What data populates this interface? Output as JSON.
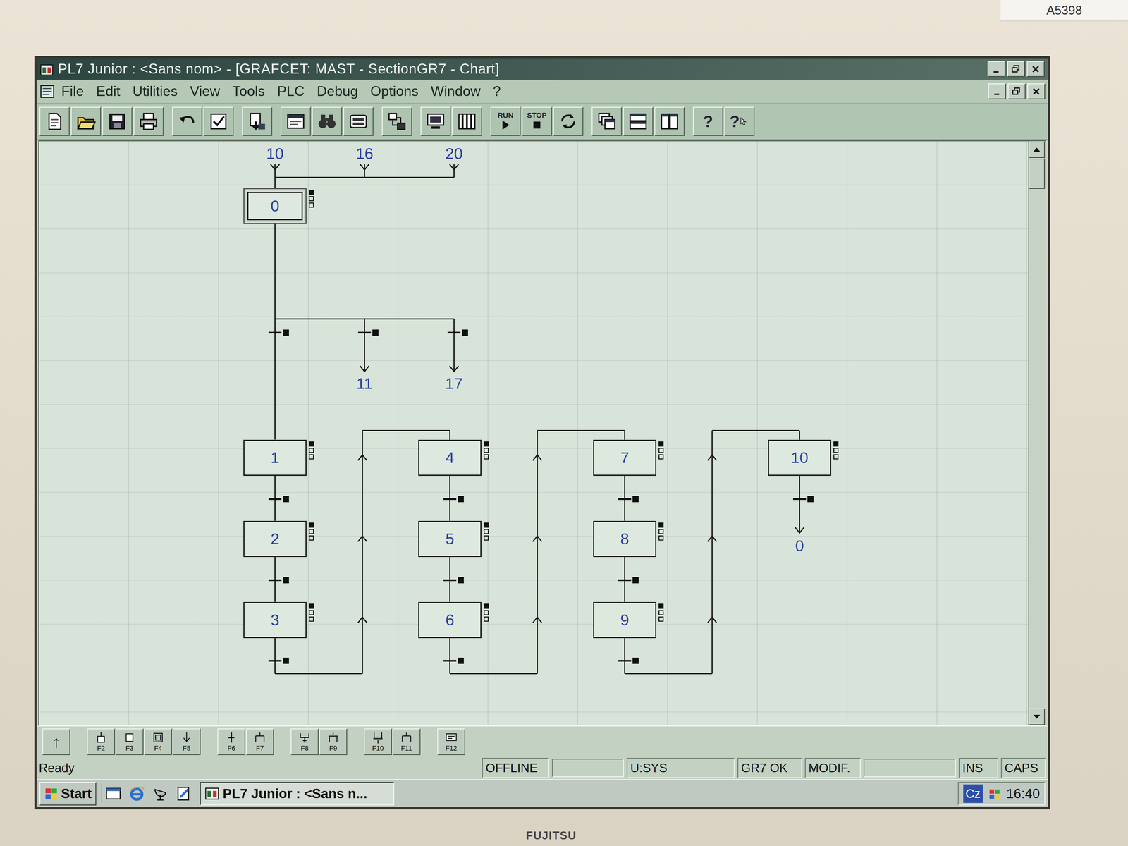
{
  "sticker": "A5398",
  "brand": "FUJITSU",
  "window": {
    "title": "PL7 Junior : <Sans nom> - [GRAFCET: MAST - SectionGR7 - Chart]"
  },
  "menu": [
    "File",
    "Edit",
    "Utilities",
    "View",
    "Tools",
    "PLC",
    "Debug",
    "Options",
    "Window",
    "?"
  ],
  "toolbar": [
    {
      "label": "RUN"
    },
    {
      "label": "STOP"
    },
    {
      "label": "?"
    },
    {
      "label": "?"
    }
  ],
  "chart": {
    "inputs": [
      "10",
      "16",
      "20"
    ],
    "initial_step": {
      "label": "0",
      "initial": true
    },
    "branches": [
      "11",
      "17"
    ],
    "sequences": [
      {
        "steps": [
          "1",
          "2",
          "3"
        ],
        "to_next": true
      },
      {
        "steps": [
          "4",
          "5",
          "6"
        ],
        "to_next": true
      },
      {
        "steps": [
          "7",
          "8",
          "9"
        ],
        "to_next": true
      },
      {
        "steps": [
          "10"
        ],
        "to_next": false,
        "jump": "0"
      }
    ]
  },
  "bottom_tools": {
    "up": "↑",
    "keys": [
      "F2",
      "F3",
      "F4",
      "F5",
      "F6",
      "F7",
      "F8",
      "F9",
      "F10",
      "F11",
      "F12"
    ]
  },
  "status_bar": {
    "message": "Ready",
    "fields": [
      "OFFLINE",
      "U:SYS",
      "GR7 OK",
      "MODIF.",
      "INS",
      "CAPS"
    ]
  },
  "taskbar": {
    "start": "Start",
    "tasks": [
      {
        "label": "PL7 Junior : <Sans n...",
        "selected": true
      }
    ],
    "language": "Cz",
    "clock": "16:40"
  }
}
